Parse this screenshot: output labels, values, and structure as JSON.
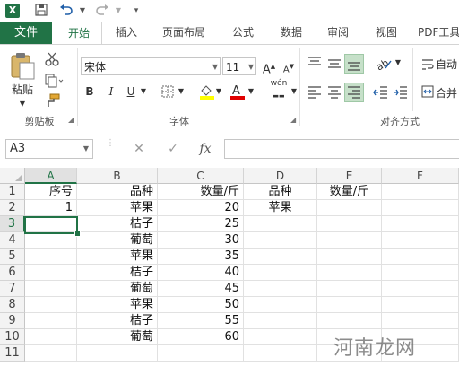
{
  "qat": {
    "logo": "X",
    "save_icon": "save-icon",
    "undo_icon": "undo-icon",
    "redo_icon": "redo-icon"
  },
  "tabs": [
    "文件",
    "开始",
    "插入",
    "页面布局",
    "公式",
    "数据",
    "审阅",
    "视图",
    "PDF工具"
  ],
  "active_tab": "开始",
  "ribbon": {
    "clipboard": {
      "paste_label": "粘贴",
      "group_label": "剪贴板"
    },
    "font": {
      "font_name": "宋体",
      "font_size": "11",
      "group_label": "字体",
      "bold": "B",
      "italic": "I",
      "underline": "U",
      "wen": "wén",
      "grow": "A",
      "shrink": "A"
    },
    "alignment": {
      "group_label": "对齐方式",
      "wrap_label": "自动",
      "merge_label": "合并"
    }
  },
  "formula_bar": {
    "name_box": "A3",
    "fx": "fx",
    "formula": ""
  },
  "columns": [
    "A",
    "B",
    "C",
    "D",
    "E",
    "F"
  ],
  "selected_column": "A",
  "selected_row": "3",
  "rows": [
    {
      "n": "1",
      "A": "序号",
      "B": "品种",
      "C": "数量/斤",
      "D": "品种",
      "E": "数量/斤"
    },
    {
      "n": "2",
      "A": "1",
      "B": "苹果",
      "C": "20",
      "D": "苹果",
      "E": ""
    },
    {
      "n": "3",
      "A": "",
      "B": "桔子",
      "C": "25",
      "D": "",
      "E": ""
    },
    {
      "n": "4",
      "A": "",
      "B": "葡萄",
      "C": "30",
      "D": "",
      "E": ""
    },
    {
      "n": "5",
      "A": "",
      "B": "苹果",
      "C": "35",
      "D": "",
      "E": ""
    },
    {
      "n": "6",
      "A": "",
      "B": "桔子",
      "C": "40",
      "D": "",
      "E": ""
    },
    {
      "n": "7",
      "A": "",
      "B": "葡萄",
      "C": "45",
      "D": "",
      "E": ""
    },
    {
      "n": "8",
      "A": "",
      "B": "苹果",
      "C": "50",
      "D": "",
      "E": ""
    },
    {
      "n": "9",
      "A": "",
      "B": "桔子",
      "C": "55",
      "D": "",
      "E": ""
    },
    {
      "n": "10",
      "A": "",
      "B": "葡萄",
      "C": "60",
      "D": "",
      "E": ""
    },
    {
      "n": "11",
      "A": "",
      "B": "",
      "C": "",
      "D": "",
      "E": ""
    }
  ],
  "watermark": "河南龙网",
  "colors": {
    "accent": "#217346"
  }
}
